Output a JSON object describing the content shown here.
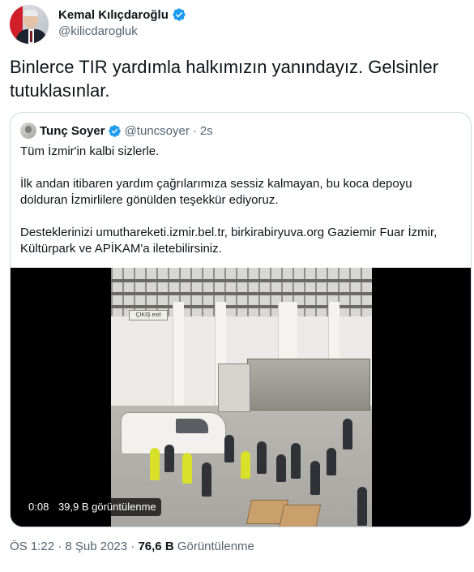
{
  "tweet": {
    "author": {
      "name": "Kemal Kılıçdaroğlu",
      "handle": "@kilicdarogluk",
      "verified": true
    },
    "text": "Binlerce TIR yardımla halkımızın yanındayız. Gelsinler tutuklasınlar.",
    "date": "ÖS 1:22 · 8 Şub 2023",
    "dot": "·",
    "views_count": "76,6 B",
    "views_label": "Görüntülenme"
  },
  "quote": {
    "author": {
      "name": "Tunç Soyer",
      "handle": "@tuncsoyer",
      "verified": true
    },
    "separator": "·",
    "time": "2s",
    "paragraphs": [
      "Tüm İzmir'in kalbi sizlerle.",
      "İlk andan itibaren yardım çağrılarımıza sessiz kalmayan, bu koca depoyu dolduran İzmirlilere gönülden teşekkür ediyoruz.",
      "Desteklerinizi umuthareketi.izmir.bel.tr, birkirabiryuva.org Gaziemir Fuar İzmir, Kültürpark ve APİKAM'a iletebilirsiniz."
    ],
    "video": {
      "elapsed": "0:08",
      "views": "39,9 B görüntülenme",
      "sign_text": "ÇIKIŞ exit"
    }
  },
  "colors": {
    "verified": "#1d9bf0",
    "text_primary": "#0f1419",
    "text_secondary": "#536471",
    "border": "#cfd9de"
  },
  "icons": {
    "verified": "verified-badge-icon"
  }
}
